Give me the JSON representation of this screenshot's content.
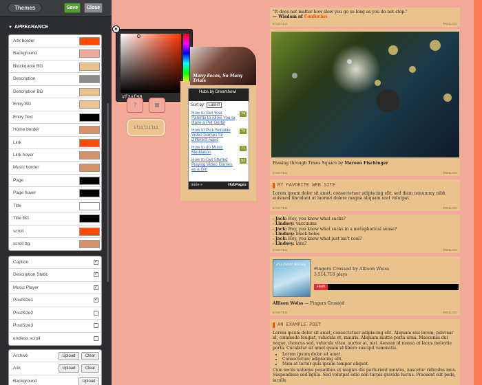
{
  "toolbar": {
    "themes": "Themes",
    "save": "Save",
    "close": "Close"
  },
  "appearance": {
    "heading": "APPEARANCE"
  },
  "colors": [
    {
      "label": "Ask border",
      "color": "#ff4a00"
    },
    {
      "label": "Background",
      "color": "#f3a99a"
    },
    {
      "label": "Blockquote BG",
      "color": "#e9c28e"
    },
    {
      "label": "Description",
      "color": "#8a8a8a"
    },
    {
      "label": "Description BG",
      "color": "#e9c28e"
    },
    {
      "label": "Entry BG",
      "color": "#e9c28e"
    },
    {
      "label": "Entry Text",
      "color": "#000000"
    },
    {
      "label": "Home border",
      "color": "#d2926a"
    },
    {
      "label": "Link",
      "color": "#ff4a00"
    },
    {
      "label": "Link hover",
      "color": "#d2926a"
    },
    {
      "label": "Music border",
      "color": "#d2926a"
    },
    {
      "label": "Page",
      "color": "#000000"
    },
    {
      "label": "Page hover",
      "color": "#000000"
    },
    {
      "label": "Title",
      "color": "#ffffff"
    },
    {
      "label": "Title BG",
      "color": "#000000"
    },
    {
      "label": "scroll",
      "color": "#ff4a00"
    },
    {
      "label": "scroll bg",
      "color": "#d2926a"
    }
  ],
  "options": [
    {
      "label": "Caption",
      "checked": true
    },
    {
      "label": "Description Static",
      "checked": true
    },
    {
      "label": "Music Player",
      "checked": true
    },
    {
      "label": "PostSize1",
      "checked": true
    },
    {
      "label": "PostSize2",
      "checked": false
    },
    {
      "label": "PostSize3",
      "checked": false
    },
    {
      "label": "endless scroll",
      "checked": false
    }
  ],
  "images": [
    {
      "label": "Archive",
      "upload": "Upload",
      "clear": "Clear"
    },
    {
      "label": "Ask",
      "upload": "Upload",
      "clear": "Clear"
    },
    {
      "label": "Background",
      "upload": "Upload"
    }
  ],
  "picker": {
    "value": "#f3af98"
  },
  "header": {
    "caption": "Many Faces, So Many Trials"
  },
  "hubs": {
    "title": "Hubs by Dreamhowl",
    "sort_label": "Sort by:",
    "sort_value": "Latest",
    "items": [
      {
        "text": "How to Get Your Parents to Allow You to Have a Pet Gerbil",
        "score": "74"
      },
      {
        "text": "How to Pick Suitable Video Games for Different Ages",
        "score": "74"
      },
      {
        "text": "How to do Music Meditation",
        "score": "71"
      },
      {
        "text": "How to Get Started Playing Video Games as a Girl",
        "score": "82"
      }
    ],
    "more": "more »",
    "brand": "HubPages"
  },
  "quote": {
    "text": "\"It does not matter how slow you go so long as you do not stop.\"",
    "author_prefix": "— Wisdom of ",
    "author": "Confucius",
    "notes": "0 NOTES",
    "reblog": "REBLOG"
  },
  "photo": {
    "caption_prefix": "Passing through Times Square by ",
    "caption_author": "Mareen Fischinger",
    "notes": "0 NOTES",
    "reblog": "REBLOG"
  },
  "fav": {
    "title": "MY FAVORITE WEB SITE",
    "body": "Lorem ipsum dolor sit amet, consectetuer adipiscing elit, sed diam nonummy nibh euismod tincidunt ut laoreet dolore magna aliquam erat volutpat.",
    "notes": "0 NOTES",
    "reblog": "REBLOG"
  },
  "chat": {
    "lines": [
      {
        "who": "Jack:",
        "said": "Hey, you know what sucks?"
      },
      {
        "who": "Lindsey:",
        "said": "vaccuums"
      },
      {
        "who": "Jack:",
        "said": "Hey, you know what sucks in a metaphorical sense?"
      },
      {
        "who": "Lindsey:",
        "said": "black holes"
      },
      {
        "who": "Jack:",
        "said": "Hey, you know what just isn't cool?"
      },
      {
        "who": "Lindsey:",
        "said": "lava?"
      }
    ],
    "notes": "0 NOTES",
    "reblog": "REBLOG"
  },
  "audio": {
    "track": "Fingers Crossed by Allison Weiss",
    "plays": "3,514,718 plays",
    "flash": "Flash",
    "art_text": "ALLISON WEISS",
    "artist": "Allison Weiss",
    "song": "Fingers Crossed",
    "notes": "0 NOTES",
    "reblog": "REBLOG"
  },
  "example": {
    "title": "AN EXAMPLE POST",
    "p1": "Lorem ipsum dolor sit amet, consectetuer adipiscing elit. Aliquam nisi lorem, pulvinar id, commodo feugiat, vehicula et, mauris. Aliquam mattis porta urna. Maecenas dui neque, rhoncus sed, vehicula vitae, auctor at, nisi. Aenean id massa ut lacus molestie porta. Curabitur sit amet quam id libero suscipit venenatis.",
    "bullets": [
      "Lorem ipsum dolor sit amet.",
      "Consectetuer adipiscing elit.",
      "Nam at tortor quis ipsum tempor aliquet."
    ],
    "p2": "Cum sociis natoque penatibus et magnis dis parturient montes, nascetur ridiculus mus. Suspendisse sed ligula. Sed volutpat odio non turpis gravida luctus. Praesent elit pede, iaculis"
  }
}
